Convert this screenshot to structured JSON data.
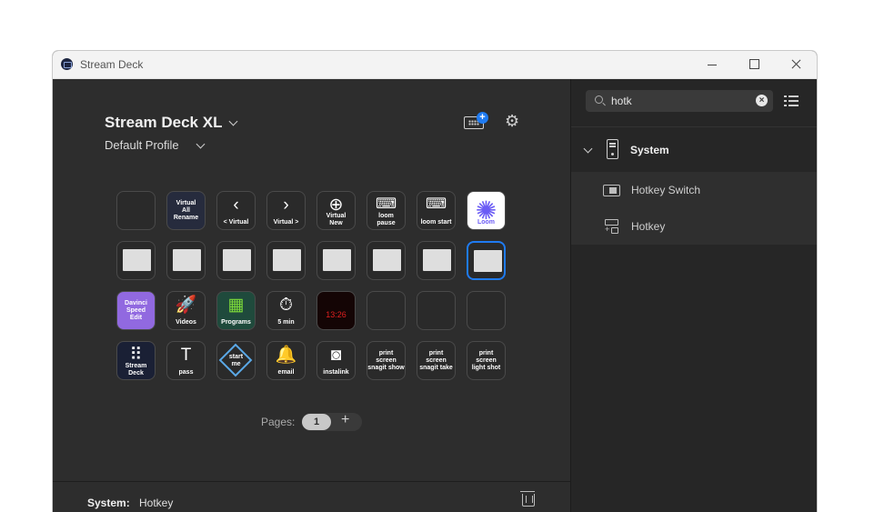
{
  "window": {
    "title": "Stream Deck"
  },
  "header": {
    "device": "Stream Deck XL",
    "profile": "Default Profile"
  },
  "keys": [
    [
      {
        "type": "empty",
        "label": ""
      },
      {
        "type": "text",
        "label": "Virtual\nAll\nRename",
        "bg": "#262b3d"
      },
      {
        "type": "icon",
        "icon": "chevron-left",
        "glyph": "‹",
        "label": "< Virtual"
      },
      {
        "type": "icon",
        "icon": "chevron-right",
        "glyph": "›",
        "label": "Virtual >"
      },
      {
        "type": "icon",
        "icon": "plus-circle",
        "glyph": "⊕",
        "label": "Virtual\nNew"
      },
      {
        "type": "icon",
        "icon": "hotkey",
        "glyph": "⌨",
        "label": "loom\npause"
      },
      {
        "type": "icon",
        "icon": "hotkey",
        "glyph": "⌨",
        "label": "loom start"
      },
      {
        "type": "icon",
        "icon": "loom-logo",
        "glyph": "✺",
        "label": "Loom",
        "bg": "#ffffff",
        "color": "#6b5cf5"
      }
    ],
    [
      {
        "type": "blank",
        "label": ""
      },
      {
        "type": "blank",
        "label": ""
      },
      {
        "type": "blank",
        "label": ""
      },
      {
        "type": "blank",
        "label": ""
      },
      {
        "type": "blank",
        "label": ""
      },
      {
        "type": "blank",
        "label": ""
      },
      {
        "type": "blank",
        "label": ""
      },
      {
        "type": "blank",
        "label": "",
        "selected": true
      }
    ],
    [
      {
        "type": "text",
        "label": "Davinci\nSpeed\nEdit",
        "bg": "#9169e0"
      },
      {
        "type": "icon",
        "icon": "rocket",
        "glyph": "🚀",
        "label": "Videos"
      },
      {
        "type": "icon",
        "icon": "apps-grid",
        "glyph": "▦",
        "label": "Programs",
        "bg": "#1f4a3c",
        "color": "#7ddb3a"
      },
      {
        "type": "icon",
        "icon": "timer",
        "glyph": "⏱",
        "label": "5 min"
      },
      {
        "type": "icon",
        "icon": "clock",
        "glyph": "13:26",
        "label": "",
        "bg": "#140505",
        "color": "#e02020"
      },
      {
        "type": "empty",
        "label": ""
      },
      {
        "type": "empty",
        "label": ""
      },
      {
        "type": "empty",
        "label": ""
      }
    ],
    [
      {
        "type": "icon",
        "icon": "streamdeck-logo",
        "glyph": "⠿",
        "label": "Stream\nDeck",
        "bg": "#1a2035"
      },
      {
        "type": "icon",
        "icon": "text",
        "glyph": "T",
        "label": "pass"
      },
      {
        "type": "text",
        "label": "start\nme",
        "bg": "#2a2a2a",
        "diamond": true
      },
      {
        "type": "icon",
        "icon": "bell",
        "glyph": "🔔",
        "label": "email"
      },
      {
        "type": "icon",
        "icon": "camera",
        "glyph": "◙",
        "label": "instalink"
      },
      {
        "type": "text",
        "label": "print\nscreen\nsnagit show"
      },
      {
        "type": "text",
        "label": "print\nscreen\nsnagit take"
      },
      {
        "type": "text",
        "label": "print\nscreen\nlight shot"
      }
    ]
  ],
  "pages": {
    "label": "Pages:",
    "current": "1",
    "add": "+"
  },
  "footer": {
    "label": "System:",
    "value": "Hotkey"
  },
  "sidebar": {
    "search_value": "hotk",
    "category": "System",
    "actions": [
      {
        "label": "Hotkey Switch",
        "icon": "switch-icon"
      },
      {
        "label": "Hotkey",
        "icon": "hotkey-icon"
      }
    ]
  }
}
